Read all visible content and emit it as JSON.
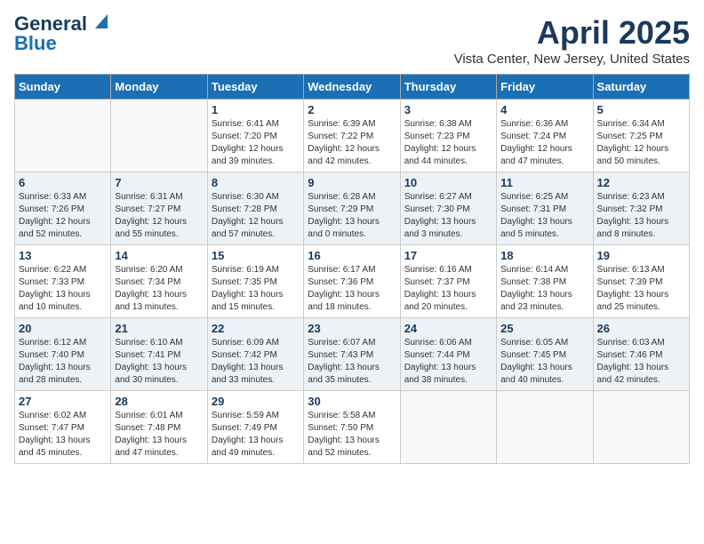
{
  "logo": {
    "line1": "General",
    "line2": "Blue"
  },
  "title": "April 2025",
  "subtitle": "Vista Center, New Jersey, United States",
  "weekdays": [
    "Sunday",
    "Monday",
    "Tuesday",
    "Wednesday",
    "Thursday",
    "Friday",
    "Saturday"
  ],
  "weeks": [
    [
      {
        "day": "",
        "info": ""
      },
      {
        "day": "",
        "info": ""
      },
      {
        "day": "1",
        "info": "Sunrise: 6:41 AM\nSunset: 7:20 PM\nDaylight: 12 hours and 39 minutes."
      },
      {
        "day": "2",
        "info": "Sunrise: 6:39 AM\nSunset: 7:22 PM\nDaylight: 12 hours and 42 minutes."
      },
      {
        "day": "3",
        "info": "Sunrise: 6:38 AM\nSunset: 7:23 PM\nDaylight: 12 hours and 44 minutes."
      },
      {
        "day": "4",
        "info": "Sunrise: 6:36 AM\nSunset: 7:24 PM\nDaylight: 12 hours and 47 minutes."
      },
      {
        "day": "5",
        "info": "Sunrise: 6:34 AM\nSunset: 7:25 PM\nDaylight: 12 hours and 50 minutes."
      }
    ],
    [
      {
        "day": "6",
        "info": "Sunrise: 6:33 AM\nSunset: 7:26 PM\nDaylight: 12 hours and 52 minutes."
      },
      {
        "day": "7",
        "info": "Sunrise: 6:31 AM\nSunset: 7:27 PM\nDaylight: 12 hours and 55 minutes."
      },
      {
        "day": "8",
        "info": "Sunrise: 6:30 AM\nSunset: 7:28 PM\nDaylight: 12 hours and 57 minutes."
      },
      {
        "day": "9",
        "info": "Sunrise: 6:28 AM\nSunset: 7:29 PM\nDaylight: 13 hours and 0 minutes."
      },
      {
        "day": "10",
        "info": "Sunrise: 6:27 AM\nSunset: 7:30 PM\nDaylight: 13 hours and 3 minutes."
      },
      {
        "day": "11",
        "info": "Sunrise: 6:25 AM\nSunset: 7:31 PM\nDaylight: 13 hours and 5 minutes."
      },
      {
        "day": "12",
        "info": "Sunrise: 6:23 AM\nSunset: 7:32 PM\nDaylight: 13 hours and 8 minutes."
      }
    ],
    [
      {
        "day": "13",
        "info": "Sunrise: 6:22 AM\nSunset: 7:33 PM\nDaylight: 13 hours and 10 minutes."
      },
      {
        "day": "14",
        "info": "Sunrise: 6:20 AM\nSunset: 7:34 PM\nDaylight: 13 hours and 13 minutes."
      },
      {
        "day": "15",
        "info": "Sunrise: 6:19 AM\nSunset: 7:35 PM\nDaylight: 13 hours and 15 minutes."
      },
      {
        "day": "16",
        "info": "Sunrise: 6:17 AM\nSunset: 7:36 PM\nDaylight: 13 hours and 18 minutes."
      },
      {
        "day": "17",
        "info": "Sunrise: 6:16 AM\nSunset: 7:37 PM\nDaylight: 13 hours and 20 minutes."
      },
      {
        "day": "18",
        "info": "Sunrise: 6:14 AM\nSunset: 7:38 PM\nDaylight: 13 hours and 23 minutes."
      },
      {
        "day": "19",
        "info": "Sunrise: 6:13 AM\nSunset: 7:39 PM\nDaylight: 13 hours and 25 minutes."
      }
    ],
    [
      {
        "day": "20",
        "info": "Sunrise: 6:12 AM\nSunset: 7:40 PM\nDaylight: 13 hours and 28 minutes."
      },
      {
        "day": "21",
        "info": "Sunrise: 6:10 AM\nSunset: 7:41 PM\nDaylight: 13 hours and 30 minutes."
      },
      {
        "day": "22",
        "info": "Sunrise: 6:09 AM\nSunset: 7:42 PM\nDaylight: 13 hours and 33 minutes."
      },
      {
        "day": "23",
        "info": "Sunrise: 6:07 AM\nSunset: 7:43 PM\nDaylight: 13 hours and 35 minutes."
      },
      {
        "day": "24",
        "info": "Sunrise: 6:06 AM\nSunset: 7:44 PM\nDaylight: 13 hours and 38 minutes."
      },
      {
        "day": "25",
        "info": "Sunrise: 6:05 AM\nSunset: 7:45 PM\nDaylight: 13 hours and 40 minutes."
      },
      {
        "day": "26",
        "info": "Sunrise: 6:03 AM\nSunset: 7:46 PM\nDaylight: 13 hours and 42 minutes."
      }
    ],
    [
      {
        "day": "27",
        "info": "Sunrise: 6:02 AM\nSunset: 7:47 PM\nDaylight: 13 hours and 45 minutes."
      },
      {
        "day": "28",
        "info": "Sunrise: 6:01 AM\nSunset: 7:48 PM\nDaylight: 13 hours and 47 minutes."
      },
      {
        "day": "29",
        "info": "Sunrise: 5:59 AM\nSunset: 7:49 PM\nDaylight: 13 hours and 49 minutes."
      },
      {
        "day": "30",
        "info": "Sunrise: 5:58 AM\nSunset: 7:50 PM\nDaylight: 13 hours and 52 minutes."
      },
      {
        "day": "",
        "info": ""
      },
      {
        "day": "",
        "info": ""
      },
      {
        "day": "",
        "info": ""
      }
    ]
  ]
}
